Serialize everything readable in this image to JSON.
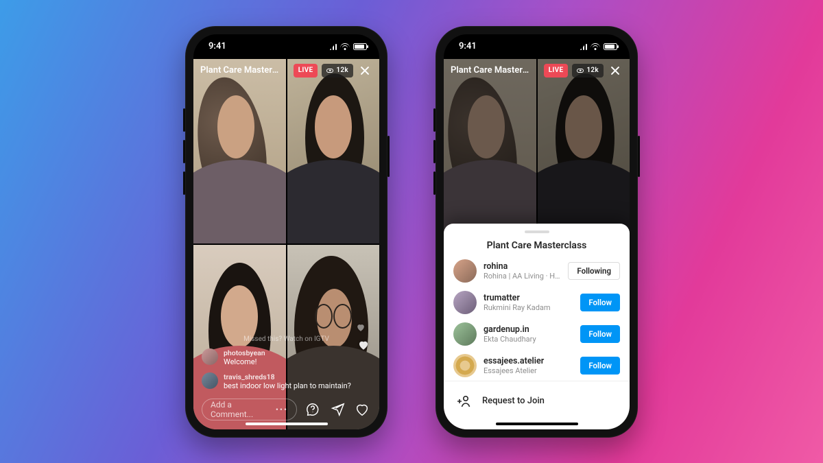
{
  "status": {
    "time": "9:41"
  },
  "header": {
    "title": "Plant Care Masterclas…",
    "live_badge": "LIVE",
    "viewer_count": "12k"
  },
  "comments": {
    "system_msg": "Missed this? Watch on IGTV",
    "items": [
      {
        "user": "photosbyean",
        "text": "Welcome!"
      },
      {
        "user": "travis_shreds18",
        "text": "best indoor low light plan to maintain?"
      }
    ],
    "placeholder": "Add a Comment..."
  },
  "sheet": {
    "title": "Plant Care Masterclass",
    "participants": [
      {
        "username": "rohina",
        "subtitle": "Rohina | AA Living · Host",
        "button": "Following",
        "state": "following"
      },
      {
        "username": "trumatter",
        "subtitle": "Rukmini Ray Kadam",
        "button": "Follow",
        "state": "follow"
      },
      {
        "username": "gardenup.in",
        "subtitle": "Ekta Chaudhary",
        "button": "Follow",
        "state": "follow"
      },
      {
        "username": "essajees.atelier",
        "subtitle": "Essajees Atelier",
        "button": "Follow",
        "state": "follow"
      }
    ],
    "request_label": "Request to Join"
  }
}
